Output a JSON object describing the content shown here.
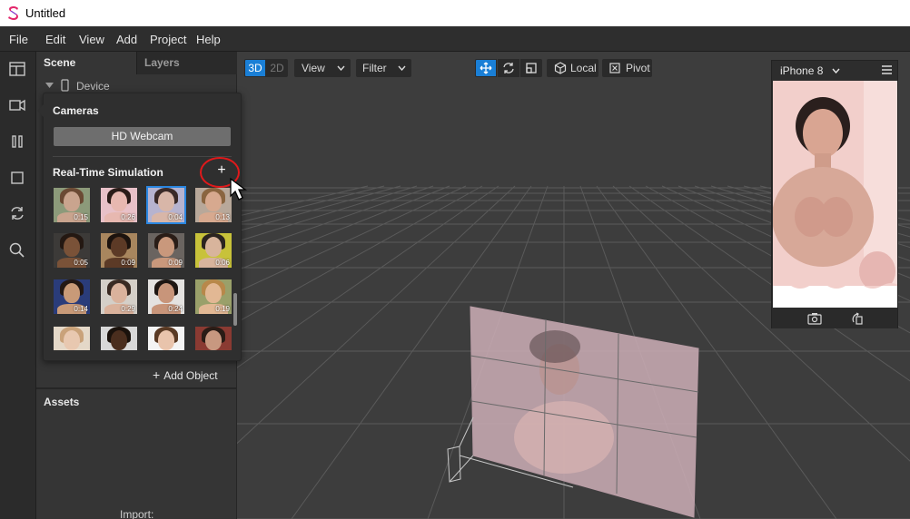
{
  "window": {
    "title": "Untitled",
    "logo_icon": "spark-ar-logo-icon"
  },
  "menu": [
    "File",
    "Edit",
    "View",
    "Add",
    "Project",
    "Help"
  ],
  "toolbar": {
    "icons": [
      "layout-icon",
      "video-camera-icon",
      "pause-icon",
      "stop-square-icon",
      "refresh-icon",
      "search-icon"
    ]
  },
  "scene_panel": {
    "tabs": {
      "scene": "Scene",
      "layers": "Layers"
    },
    "tree": {
      "device": "Device"
    },
    "add_object": "Add Object",
    "assets": "Assets",
    "import": "Import:"
  },
  "popup": {
    "cameras_label": "Cameras",
    "webcam_button": "HD Webcam",
    "simulation_label": "Real-Time Simulation",
    "add_label": "+",
    "thumbnails": [
      {
        "duration": "0:15",
        "skin": "#c9a48e",
        "hair": "#6b4a34",
        "bg": "#8c9a7a",
        "selected": false
      },
      {
        "duration": "0:26",
        "skin": "#e7b8b0",
        "hair": "#2a1c18",
        "bg": "#e8c1c8",
        "selected": false
      },
      {
        "duration": "0:04",
        "skin": "#d8b6a8",
        "hair": "#3a2a28",
        "bg": "#b6b3cf",
        "selected": true
      },
      {
        "duration": "0:13",
        "skin": "#d7a98f",
        "hair": "#8a6540",
        "bg": "#b8a89a",
        "selected": false
      },
      {
        "duration": "0:05",
        "skin": "#7a5238",
        "hair": "#241812",
        "bg": "#3c3a38",
        "selected": false
      },
      {
        "duration": "0:09",
        "skin": "#5c3a26",
        "hair": "#1c130e",
        "bg": "#a8865e",
        "selected": false
      },
      {
        "duration": "0:09",
        "skin": "#c9987c",
        "hair": "#2a1d17",
        "bg": "#6a6460",
        "selected": false
      },
      {
        "duration": "0:06",
        "skin": "#d8b49c",
        "hair": "#2b2420",
        "bg": "#c8c23a",
        "selected": false
      },
      {
        "duration": "0:14",
        "skin": "#c89a78",
        "hair": "#231814",
        "bg": "#2a3c7a",
        "selected": false
      },
      {
        "duration": "0:29",
        "skin": "#dab29c",
        "hair": "#3a2a22",
        "bg": "#d4cfc8",
        "selected": false
      },
      {
        "duration": "0:24",
        "skin": "#c8957a",
        "hair": "#1e1612",
        "bg": "#e4e2e0",
        "selected": false
      },
      {
        "duration": "0:19",
        "skin": "#e2b894",
        "hair": "#b8884a",
        "bg": "#9aa06a",
        "selected": false
      },
      {
        "duration": "",
        "skin": "#e8c8b0",
        "hair": "#c9a27a",
        "bg": "#e4d8c8",
        "selected": false
      },
      {
        "duration": "",
        "skin": "#4a2e1e",
        "hair": "#1a120c",
        "bg": "#d8d8d8",
        "selected": false
      },
      {
        "duration": "",
        "skin": "#e9c4ac",
        "hair": "#5a3a24",
        "bg": "#f4f4f4",
        "selected": false
      },
      {
        "duration": "",
        "skin": "#c89880",
        "hair": "#2a1c16",
        "bg": "#8a3a32",
        "selected": false
      }
    ]
  },
  "viewport": {
    "mode_3d": "3D",
    "mode_2d": "2D",
    "view_menu": "View",
    "filter_menu": "Filter",
    "local_label": "Local",
    "pivot_label": "Pivot",
    "accent": "#1a7fd6"
  },
  "preview": {
    "device": "iPhone 8",
    "screen_bg": "#f0c9c6",
    "bottom_icons": [
      "camera-switch-icon",
      "rotate-icon"
    ]
  },
  "annotation": {
    "ring_color": "#e0191b"
  }
}
